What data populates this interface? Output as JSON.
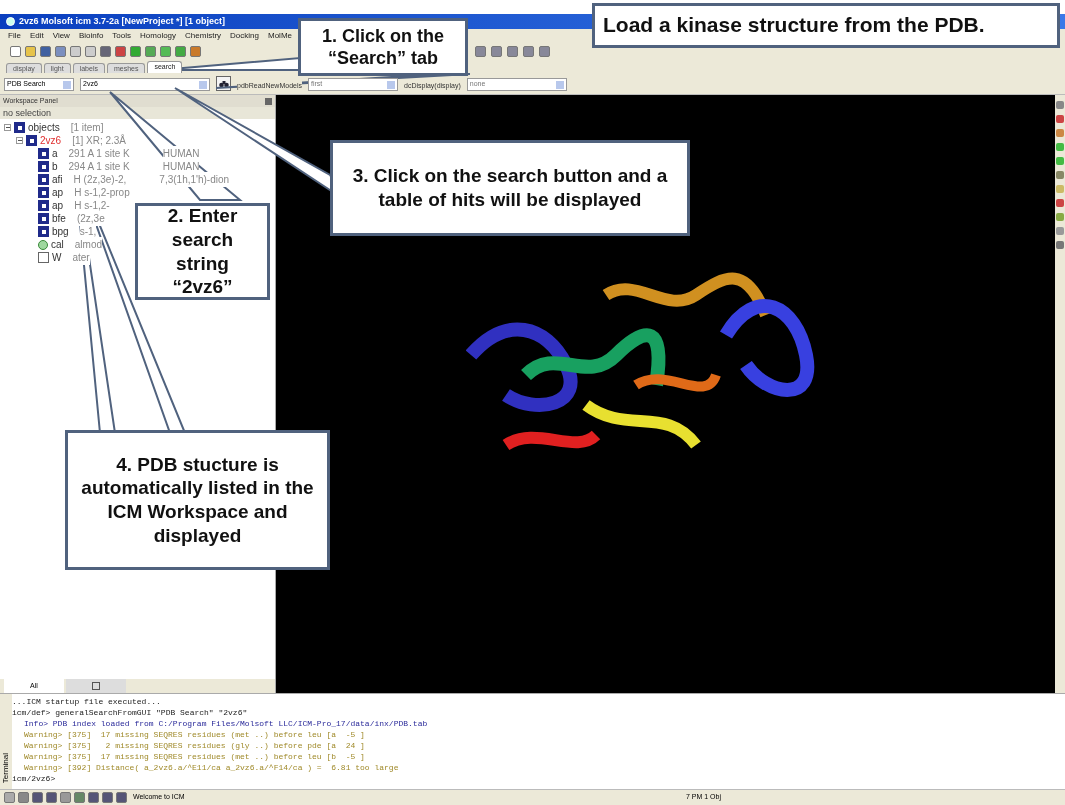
{
  "window": {
    "title": "2vz6 Molsoft icm 3.7-2a  [NewProject *] [1 object]"
  },
  "menu": [
    "File",
    "Edit",
    "View",
    "Bioinfo",
    "Tools",
    "Homology",
    "Chemistry",
    "Docking",
    "MolMe"
  ],
  "tabs": [
    {
      "label": "display",
      "selected": false
    },
    {
      "label": "light",
      "selected": false
    },
    {
      "label": "labels",
      "selected": false
    },
    {
      "label": "meshes",
      "selected": false
    },
    {
      "label": "search",
      "selected": true
    }
  ],
  "search": {
    "source": "PDB Search",
    "value": "2vz6",
    "option_label": "pdbReadNewModels",
    "option_value": "first",
    "option2_label": "dcDisplay(display)",
    "option2_value": "none"
  },
  "workspace": {
    "title": "Workspace Panel",
    "selection": "no selection",
    "bottom_tabs": [
      {
        "label": "All",
        "selected": true
      },
      {
        "kind": "icon",
        "selected": false
      }
    ],
    "tree": [
      {
        "name": "objects",
        "info": "[1 item]",
        "displayed": true,
        "expanded": true,
        "children": [
          {
            "name": "2vz6",
            "info": "[1] XR; 2.3Å",
            "displayed": true,
            "expanded": true,
            "highlight": true,
            "children": [
              {
                "name": "a",
                "info": "291 A  1 site K",
                "info_2": "HUMAN",
                "displayed": true,
                "kind": "object"
              },
              {
                "name": "b",
                "info": "294 A  1 site K",
                "info_2": "HUMAN",
                "displayed": true,
                "kind": "object"
              },
              {
                "name": "afi",
                "info": "H  (2z,3e)-2,",
                "info_2": "7,3(1h,1'h)-dion",
                "displayed": true,
                "kind": "object"
              },
              {
                "name": "ap",
                "info": "H  s-1,2-prop",
                "displayed": true,
                "kind": "object"
              },
              {
                "name": "ap",
                "info": "H  s-1,2-",
                "displayed": true,
                "kind": "object"
              },
              {
                "name": "bfe",
                "info": "(2z,3e",
                "displayed": true,
                "kind": "object"
              },
              {
                "name": "bpg",
                "info": "s-1,",
                "displayed": true,
                "kind": "object"
              },
              {
                "name": "cal",
                "info": "almod",
                "displayed": true,
                "kind": "ion"
              },
              {
                "name": "W",
                "info": "ater",
                "displayed": false,
                "kind": "object"
              }
            ]
          }
        ]
      }
    ]
  },
  "terminal": {
    "side_label": "Terminal",
    "lines": [
      {
        "kind": "command",
        "text": "...ICM startup file executed..."
      },
      {
        "kind": "command",
        "text": "icm/def> generalSearchFromGUI \"PDB Search\" \"2vz6\""
      },
      {
        "kind": "info",
        "text": "Info> PDB index loaded from C:/Program Files/Molsoft LLC/ICM-Pro_17/data/inx/PDB.tab"
      },
      {
        "kind": "warning",
        "text": "Warning> [375]  17 missing SEQRES residues (met ..) before leu [a  -5 ]"
      },
      {
        "kind": "warning",
        "text": "Warning> [375]   2 missing SEQRES residues (gly ..) before pde [a  24 ]"
      },
      {
        "kind": "warning",
        "text": "Warning> [375]  17 missing SEQRES residues (met ..) before leu [b  -5 ]"
      },
      {
        "kind": "warning",
        "text": "Warning> [392] Distance( a_2vz6.a/^E11/ca a_2vz6.a/^F14/ca ) =  6.81 too large"
      },
      {
        "kind": "command",
        "text": "icm/2vz6> "
      }
    ]
  },
  "status_bar": {
    "message": "Welcome to ICM",
    "right": "7 PM 1 Obj"
  },
  "callouts": [
    {
      "kind": "heading",
      "text": "Load a kinase structure from the PDB."
    },
    {
      "kind": "step1",
      "text": "1. Click on the “Search” tab"
    },
    {
      "kind": "step3",
      "text": "3. Click on the search button and a table of hits will be displayed"
    },
    {
      "kind": "step2",
      "text": "2. Enter search string “2vz6”"
    },
    {
      "kind": "step4",
      "text": "4. PDB stucture is automatically listed in the ICM Workspace and displayed"
    }
  ]
}
